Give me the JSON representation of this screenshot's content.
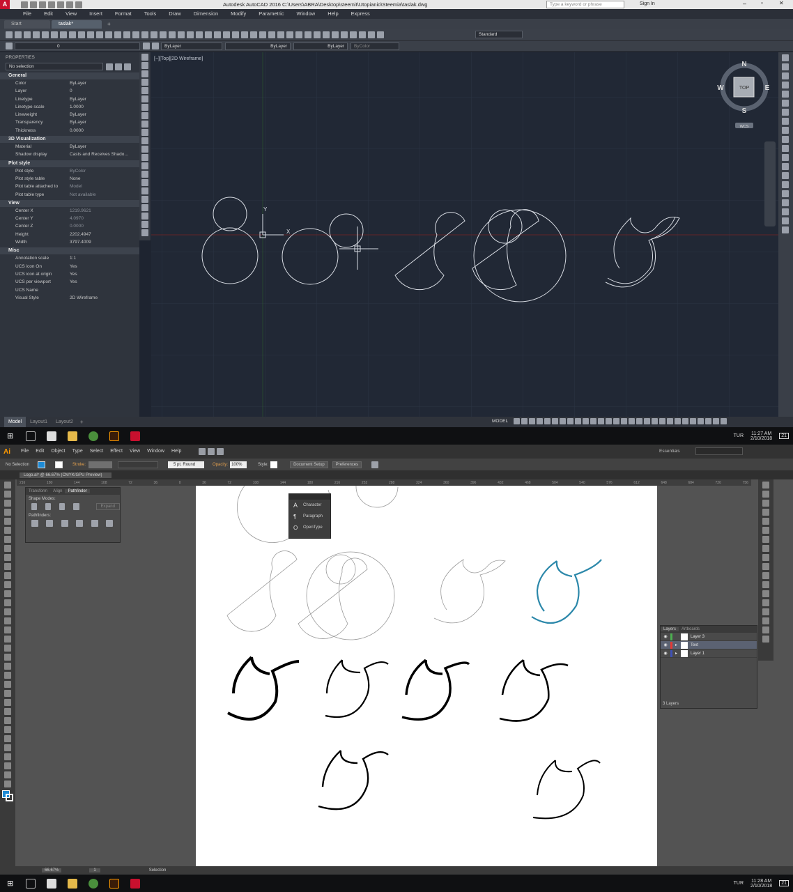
{
  "autocad": {
    "title": "Autodesk AutoCAD 2016    C:\\Users\\ABRA\\Desktop\\steemit\\Utopianio\\Steemia\\taslak.dwg",
    "search_placeholder": "Type a keyword or phrase",
    "sign_in": "Sign In",
    "menu": [
      "File",
      "Edit",
      "View",
      "Insert",
      "Format",
      "Tools",
      "Draw",
      "Dimension",
      "Modify",
      "Parametric",
      "Window",
      "Help",
      "Express"
    ],
    "file_tabs": [
      "Start",
      "taslak*"
    ],
    "layer_value": "0",
    "text_style": "Standard",
    "color_dd": "ByLayer",
    "linetype_dd": "ByLayer",
    "lineweight_dd": "ByLayer",
    "plotstyle_dd": "ByColor",
    "properties": {
      "title": "PROPERTIES",
      "selection": "No selection",
      "sections": [
        {
          "name": "General",
          "rows": [
            [
              "Color",
              "ByLayer"
            ],
            [
              "Layer",
              "0"
            ],
            [
              "Linetype",
              "ByLayer"
            ],
            [
              "Linetype scale",
              "1.0000"
            ],
            [
              "Lineweight",
              "ByLayer"
            ],
            [
              "Transparency",
              "ByLayer"
            ],
            [
              "Thickness",
              "0.0000"
            ]
          ]
        },
        {
          "name": "3D Visualization",
          "rows": [
            [
              "Material",
              "ByLayer"
            ],
            [
              "Shadow display",
              "Casts and Receives Shado..."
            ]
          ]
        },
        {
          "name": "Plot style",
          "rows": [
            [
              "Plot style",
              "ByColor"
            ],
            [
              "Plot style table",
              "None"
            ],
            [
              "Plot table attached to",
              "Model"
            ],
            [
              "Plot table type",
              "Not available"
            ]
          ]
        },
        {
          "name": "View",
          "rows": [
            [
              "Center X",
              "1219.9621"
            ],
            [
              "Center Y",
              "4.0970"
            ],
            [
              "Center Z",
              "0.0000"
            ],
            [
              "Height",
              "2202.4947"
            ],
            [
              "Width",
              "3797.4009"
            ]
          ]
        },
        {
          "name": "Misc",
          "rows": [
            [
              "Annotation scale",
              "1:1"
            ],
            [
              "UCS icon On",
              "Yes"
            ],
            [
              "UCS icon at origin",
              "Yes"
            ],
            [
              "UCS per viewport",
              "Yes"
            ],
            [
              "UCS Name",
              ""
            ],
            [
              "Visual Style",
              "2D Wireframe"
            ]
          ]
        }
      ]
    },
    "viewport_label": "[−][Top][2D Wireframe]",
    "viewcube": {
      "n": "N",
      "s": "S",
      "e": "E",
      "w": "W",
      "top": "TOP",
      "wcs": "WCS"
    },
    "ucs": {
      "x": "X",
      "y": "Y"
    },
    "layout_tabs": [
      "Model",
      "Layout1",
      "Layout2"
    ],
    "status_model": "MODEL"
  },
  "taskbar_top": {
    "time": "11:27 AM",
    "date": "2/10/2018",
    "lang": "TUR",
    "notif": "21"
  },
  "illustrator": {
    "logo": "Ai",
    "menu": [
      "File",
      "Edit",
      "Object",
      "Type",
      "Select",
      "Effect",
      "View",
      "Window",
      "Help"
    ],
    "workspace": "Essentials",
    "no_selection": "No Selection",
    "stroke_label": "Stroke:",
    "brush": "5 pt. Round",
    "opacity_label": "Opacity:",
    "opacity": "100%",
    "style_label": "Style:",
    "doc_setup": "Document Setup",
    "preferences": "Preferences",
    "doc_tab": "Logo.ai* @ 66.67% (CMYK/GPU Preview)",
    "ruler": [
      "216",
      "180",
      "144",
      "108",
      "72",
      "36",
      "0",
      "36",
      "72",
      "108",
      "144",
      "180",
      "216",
      "252",
      "288",
      "324",
      "360",
      "396",
      "432",
      "468",
      "504",
      "540",
      "576",
      "612",
      "648",
      "684",
      "720",
      "756"
    ],
    "pathfinder": {
      "tabs": [
        "Transform",
        "Align",
        "Pathfinder"
      ],
      "shape_modes": "Shape Modes:",
      "pathfinders": "Pathfinders:",
      "expand": "Expand"
    },
    "char_panel": [
      "Character",
      "Paragraph",
      "OpenType"
    ],
    "layers": {
      "tabs": [
        "Layers",
        "Artboards"
      ],
      "items": [
        "Layer 3",
        "Text",
        "Layer 1"
      ],
      "count": "3 Layers"
    },
    "status": {
      "zoom": "66.67%",
      "page": "1",
      "tool": "Selection"
    }
  },
  "taskbar_bottom": {
    "time": "11:28 AM",
    "date": "2/10/2018",
    "lang": "TUR",
    "notif": "21"
  }
}
